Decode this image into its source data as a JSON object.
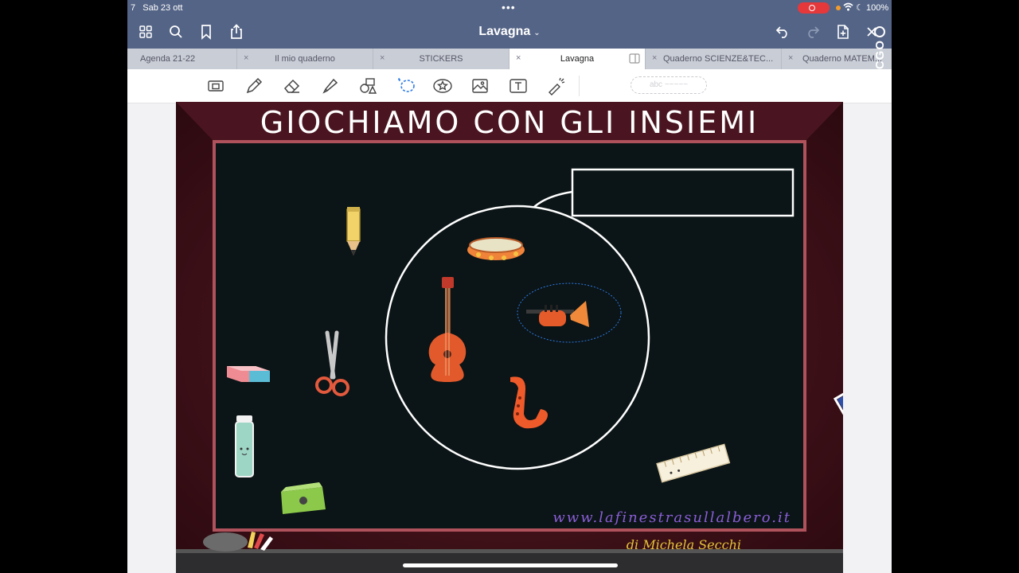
{
  "status": {
    "time_fragment": "7",
    "date": "Sab 23 ott",
    "battery": "100%",
    "dots": "•••"
  },
  "header": {
    "title": "Lavagna",
    "chevron": "⌄",
    "icons": [
      "grid-icon",
      "search-icon",
      "bookmark-icon",
      "share-icon",
      "undo-icon",
      "redo-icon",
      "add-page-icon",
      "close-icon"
    ]
  },
  "tabs": [
    {
      "label": "Agenda 21-22",
      "active": false
    },
    {
      "label": "Il mio quaderno",
      "active": false
    },
    {
      "label": "STICKERS",
      "active": false
    },
    {
      "label": "Lavagna",
      "active": true
    },
    {
      "label": "Quaderno SCIENZE&TEC...",
      "active": false
    },
    {
      "label": "Quaderno MATEM...",
      "active": false
    }
  ],
  "tab_close_glyph": "×",
  "toolbar": {
    "tools": [
      "zoom-window-icon",
      "pen-icon",
      "eraser-icon",
      "highlighter-icon",
      "shapes-icon",
      "lasso-icon",
      "sticker-icon",
      "image-icon",
      "textbox-icon",
      "laser-pointer-icon"
    ],
    "pen_preview": "abc ~~~~~"
  },
  "watermark": "ECGO",
  "page": {
    "title": "GIOCHIAMO CON GLI INSIEMI",
    "website": "www.lafinestrasullalbero.it",
    "author": "di Michela Secchi",
    "label_box_text": ""
  },
  "colors": {
    "header_bg": "#546486",
    "tabs_bg": "#c9ced6",
    "chalkboard": "#0b1416",
    "frame": "#401018",
    "website_text": "#8a5ed6",
    "author_text": "#e6c33a"
  }
}
